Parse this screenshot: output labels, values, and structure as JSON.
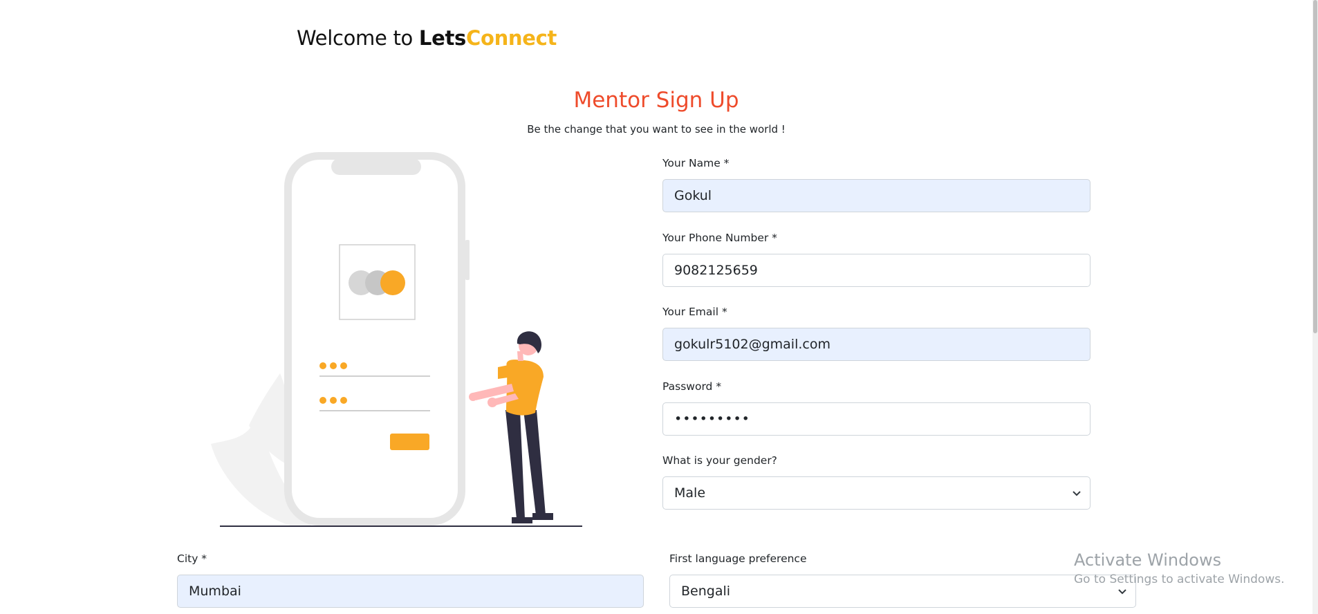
{
  "header": {
    "welcome_prefix": "Welcome to ",
    "brand_part1": "Lets",
    "brand_part2": "Connect",
    "brand_accent_color": "#f5b41a"
  },
  "form": {
    "title": "Mentor Sign Up",
    "title_color": "#ee4b2b",
    "subtitle": "Be the change that you want to see in the world !",
    "fields": {
      "name": {
        "label": "Your Name *",
        "value": "Gokul"
      },
      "phone": {
        "label": "Your Phone Number *",
        "value": "9082125659"
      },
      "email": {
        "label": "Your Email *",
        "value": "gokulr5102@gmail.com"
      },
      "password": {
        "label": "Password *",
        "value": "•••••••••"
      },
      "gender": {
        "label": "What is your gender?",
        "selected": "Male"
      },
      "city": {
        "label": "City *",
        "value": "Mumbai"
      },
      "language": {
        "label": "First language preference",
        "selected": "Bengali"
      }
    }
  },
  "illustration": {
    "description_icon": "phone-login-illustration",
    "accent_color": "#f9a826"
  },
  "watermark": {
    "line1": "Activate Windows",
    "line2": "Go to Settings to activate Windows."
  }
}
